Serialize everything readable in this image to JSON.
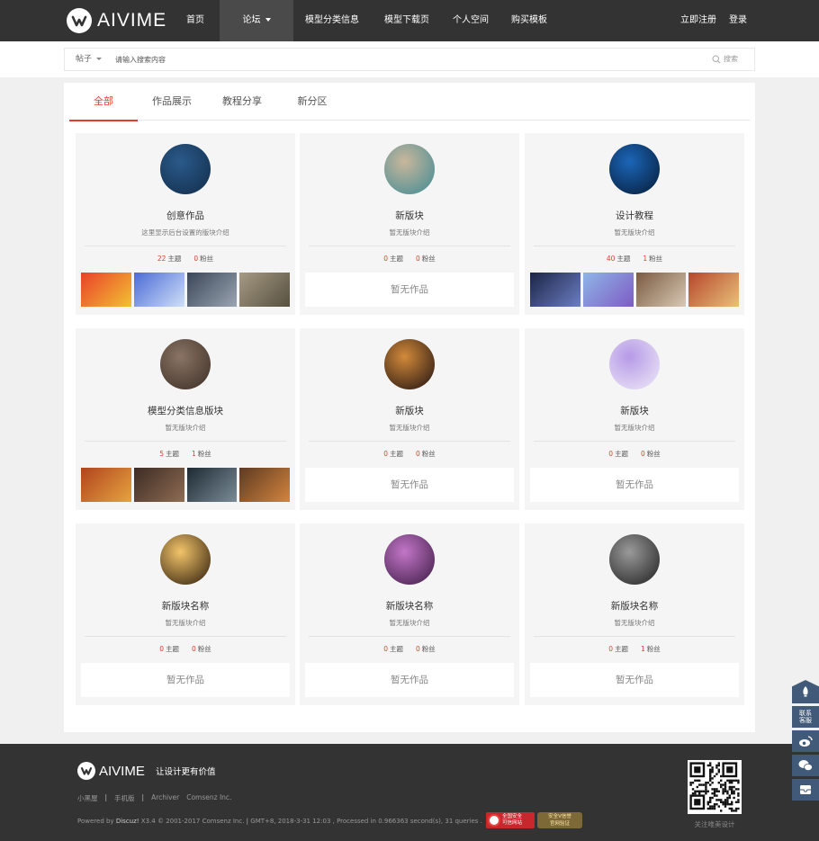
{
  "header": {
    "logo_text": "AIVIME",
    "nav": [
      {
        "label": "首页",
        "width": 54,
        "active": false,
        "dropdown": false
      },
      {
        "label": "论坛",
        "width": 82,
        "active": true,
        "dropdown": true
      },
      {
        "label": "模型分类信息",
        "width": 86,
        "active": false,
        "dropdown": false
      },
      {
        "label": "模型下载页",
        "width": 80,
        "active": false,
        "dropdown": false
      },
      {
        "label": "个人空间",
        "width": 62,
        "active": false,
        "dropdown": false
      },
      {
        "label": "购买模板",
        "width": 68,
        "active": false,
        "dropdown": false
      }
    ],
    "register_label": "立即注册",
    "login_label": "登录"
  },
  "search": {
    "type_label": "帖子",
    "placeholder": "请输入搜索内容",
    "button_label": "搜索"
  },
  "tabs": [
    {
      "label": "全部",
      "active": true
    },
    {
      "label": "作品展示",
      "active": false
    },
    {
      "label": "教程分享",
      "active": false
    },
    {
      "label": "新分区",
      "active": false
    }
  ],
  "cards": [
    {
      "title": "创意作品",
      "desc": "这里显示后台设置的版块介绍",
      "topics": "22",
      "fans": "0",
      "topics_label": "主题",
      "fans_label": "粉丝",
      "avatar": [
        "#2a5a8a",
        "#122c49"
      ],
      "thumbs": [
        [
          "#e9402a",
          "#f2c233"
        ],
        [
          "#4b6bd6",
          "#cfe0f7"
        ],
        [
          "#3b4658",
          "#9aa4b2"
        ],
        [
          "#a69a84",
          "#56503f"
        ]
      ],
      "empty_label": ""
    },
    {
      "title": "新版块",
      "desc": "暂无版块介绍",
      "topics": "0",
      "fans": "0",
      "topics_label": "主题",
      "fans_label": "粉丝",
      "avatar": [
        "#c9b79c",
        "#3e8a94"
      ],
      "thumbs": [],
      "empty_label": "暂无作品"
    },
    {
      "title": "设计教程",
      "desc": "暂无版块介绍",
      "topics": "40",
      "fans": "1",
      "topics_label": "主题",
      "fans_label": "粉丝",
      "avatar": [
        "#1b66b8",
        "#061a35"
      ],
      "thumbs": [
        [
          "#1c2546",
          "#6b7ec4"
        ],
        [
          "#8fb6e8",
          "#7e5bc4"
        ],
        [
          "#7a5a40",
          "#d9c9b5"
        ],
        [
          "#b7462c",
          "#e8c27a"
        ]
      ],
      "empty_label": ""
    },
    {
      "title": "模型分类信息版块",
      "desc": "暂无版块介绍",
      "topics": "5",
      "fans": "1",
      "topics_label": "主题",
      "fans_label": "粉丝",
      "avatar": [
        "#8a7464",
        "#3b2d25"
      ],
      "thumbs": [
        [
          "#b0441f",
          "#e7a33f"
        ],
        [
          "#3d2b23",
          "#8e6d54"
        ],
        [
          "#1d2a33",
          "#7b8c96"
        ],
        [
          "#5e3a22",
          "#d4853e"
        ]
      ],
      "empty_label": ""
    },
    {
      "title": "新版块",
      "desc": "暂无版块介绍",
      "topics": "0",
      "fans": "0",
      "topics_label": "主题",
      "fans_label": "粉丝",
      "avatar": [
        "#d28a3a",
        "#1d1010"
      ],
      "thumbs": [],
      "empty_label": "暂无作品"
    },
    {
      "title": "新版块",
      "desc": "暂无版块介绍",
      "topics": "0",
      "fans": "0",
      "topics_label": "主题",
      "fans_label": "粉丝",
      "avatar": [
        "#b69ae6",
        "#efeaf8"
      ],
      "thumbs": [],
      "empty_label": "暂无作品"
    },
    {
      "title": "新版块名称",
      "desc": "暂无版块介绍",
      "topics": "0",
      "fans": "0",
      "topics_label": "主题",
      "fans_label": "粉丝",
      "avatar": [
        "#f3c46a",
        "#2a1a0a"
      ],
      "thumbs": [],
      "empty_label": "暂无作品"
    },
    {
      "title": "新版块名称",
      "desc": "暂无版块介绍",
      "topics": "0",
      "fans": "0",
      "topics_label": "主题",
      "fans_label": "粉丝",
      "avatar": [
        "#c376c8",
        "#3a1a42"
      ],
      "thumbs": [],
      "empty_label": "暂无作品"
    },
    {
      "title": "新版块名称",
      "desc": "暂无版块介绍",
      "topics": "0",
      "fans": "1",
      "topics_label": "主题",
      "fans_label": "粉丝",
      "avatar": [
        "#9a9a9a",
        "#1e1e1e"
      ],
      "thumbs": [],
      "empty_label": "暂无作品"
    }
  ],
  "footer": {
    "logo_text": "AIVIME",
    "slogan": "让设计更有价值",
    "links": [
      "小黑屋",
      "手机版",
      "Archiver",
      "Comsenz Inc."
    ],
    "powered_prefix": "Powered by",
    "powered_name": "Discuz!",
    "version": "X3.4",
    "copyright": "© 2001-2017 Comsenz Inc.",
    "stats": "GMT+8, 2018-3-31 12:03 , Processed in 0.966363 second(s), 31 queries .",
    "badge1_line1": "全国安全",
    "badge1_line2": "可信网站",
    "badge2_line1": "安全V信誉",
    "badge2_line2": "官网验证",
    "qr_label": "关注唯美设计"
  },
  "side_tools": {
    "contact_label": "联系客服"
  }
}
